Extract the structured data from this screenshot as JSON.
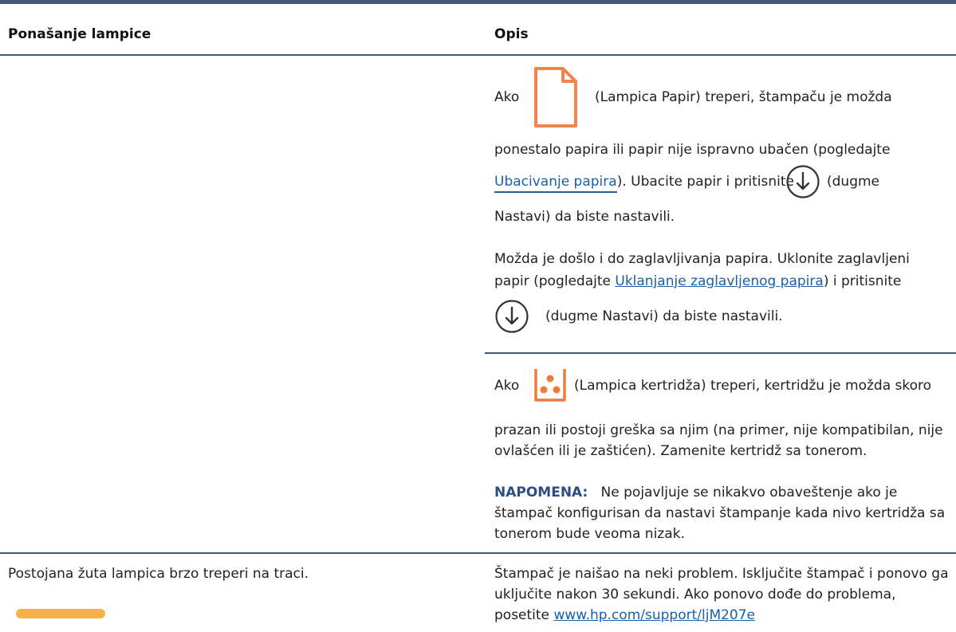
{
  "table": {
    "header": {
      "col1": "Ponašanje lampice",
      "col2": "Opis"
    },
    "row1": {
      "paper_light": {
        "line1_before": "Ako",
        "paper_icon": "paper-light-icon",
        "line1_after": "(Lampica Papir) treperi, štampaču je možda",
        "line2": "ponestalo papira ili papir nije ispravno ubačen (pogledajte",
        "link1": "Ubacivanje papira",
        "line3_after_link": "). Ubacite papir i pritisnite",
        "resume_icon": "resume-button-icon",
        "line3_end": "(dugme",
        "line4": "Nastavi) da biste nastavili."
      },
      "jam": {
        "line1": "Možda je došlo i do zaglavljivanja papira. Uklonite zaglavljeni",
        "line2_before": "papir (pogledajte ",
        "link2": "Uklanjanje zaglavljenog papira",
        "line2_after": ") i pritisnite",
        "line3": "(dugme Nastavi) da biste nastavili."
      },
      "cartridge": {
        "line1_before": "Ako",
        "cartridge_icon": "cartridge-light-icon",
        "line1_after": "(Lampica kertridža) treperi, kertridžu je možda skoro",
        "line2": "prazan ili postoji greška sa njim (na primer, nije kompatibilan, nije",
        "line3": "ovlašćen ili je zaštićen). Zamenite kertridž sa tonerom.",
        "note_label": "NAPOMENA:",
        "note_line1": "Ne pojavljuje se nikakvo obaveštenje ako je",
        "note_line2": "štampač konfigurisan da nastavi štampanje kada nivo kertridža sa",
        "note_line3": "tonerom bude veoma nizak."
      }
    },
    "row2": {
      "behavior": "Postojana žuta lampica brzo treperi na traci.",
      "desc_line1": "Štampač je naišao na neki problem. Isključite štampač i ponovo ga",
      "desc_line2": "uključite nakon 30 sekundi. Ako ponovo dođe do problema,",
      "desc_line3_before": "posetite ",
      "link3": "www.hp.com/support/ljM207e"
    }
  },
  "colors": {
    "rule": "#42567a",
    "link": "#1a5fa8",
    "paper_icon": "#f0844a",
    "cartridge_icon": "#f07a3a",
    "amber_bar": "#f8b04a",
    "note_label": "#2c4d80"
  }
}
